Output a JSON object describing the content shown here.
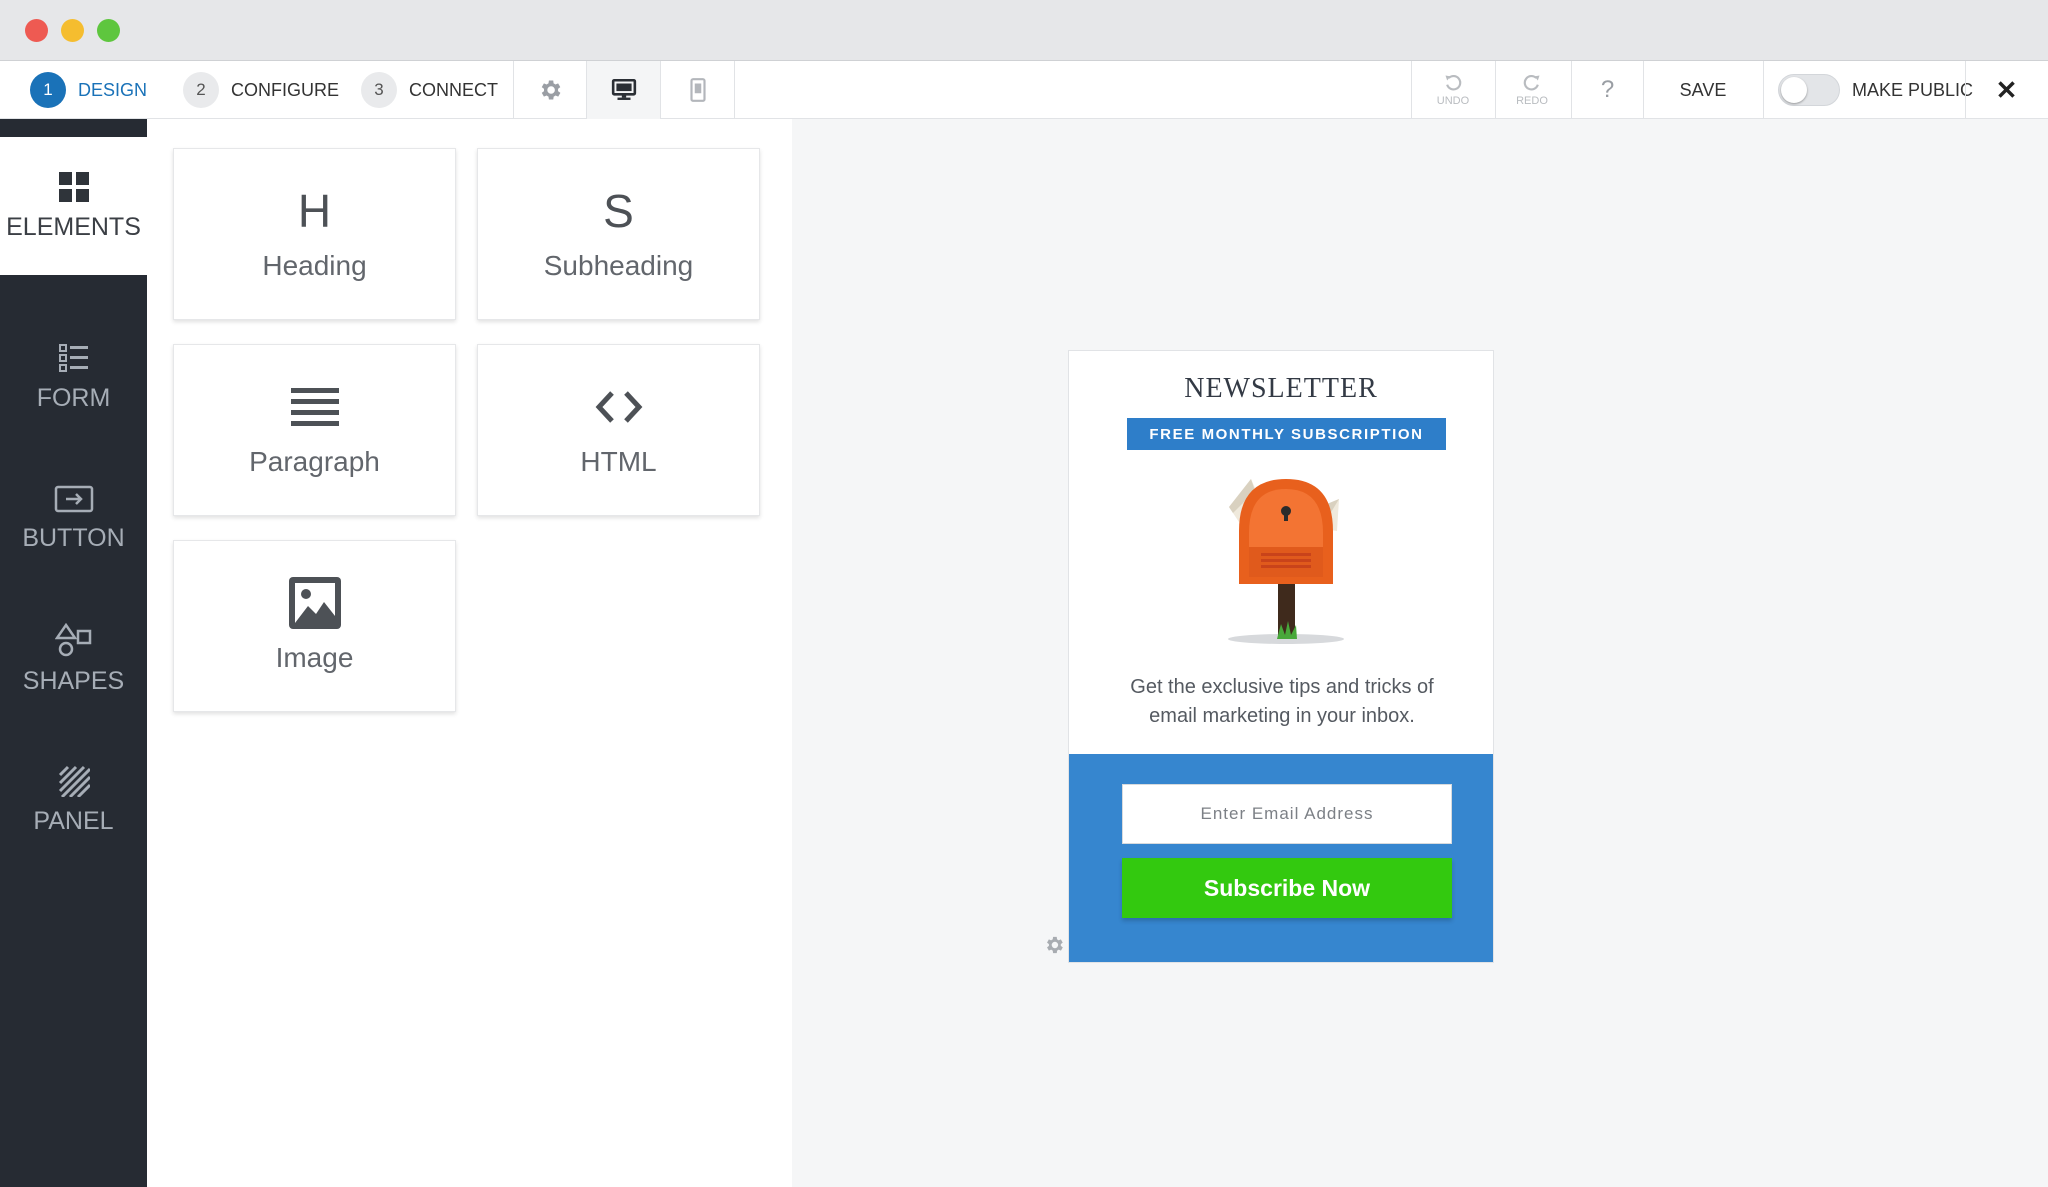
{
  "toolbar": {
    "steps": [
      {
        "num": "1",
        "label": "DESIGN"
      },
      {
        "num": "2",
        "label": "CONFIGURE"
      },
      {
        "num": "3",
        "label": "CONNECT"
      }
    ],
    "undo_label": "UNDO",
    "redo_label": "REDO",
    "help_label": "?",
    "save_label": "SAVE",
    "make_public_label": "MAKE PUBLIC",
    "close_label": "✕",
    "accent_color": "#1a72b8"
  },
  "rail": {
    "items": [
      {
        "label": "ELEMENTS",
        "icon": "grid-icon"
      },
      {
        "label": "FORM",
        "icon": "list-icon"
      },
      {
        "label": "BUTTON",
        "icon": "button-icon"
      },
      {
        "label": "SHAPES",
        "icon": "shapes-icon"
      },
      {
        "label": "PANEL",
        "icon": "panel-icon"
      }
    ]
  },
  "elements": {
    "tiles": [
      {
        "glyph": "H",
        "label": "Heading"
      },
      {
        "glyph": "S",
        "label": "Subheading"
      },
      {
        "glyph": "",
        "label": "Paragraph",
        "icon": "paragraph-icon"
      },
      {
        "glyph": "",
        "label": "HTML",
        "icon": "code-icon"
      },
      {
        "glyph": "",
        "label": "Image",
        "icon": "image-icon"
      }
    ]
  },
  "newsletter": {
    "title": "NEWSLETTER",
    "badge": "FREE MONTHLY SUBSCRIPTION",
    "body_line1": "Get the exclusive tips and tricks of",
    "body_line2": "email marketing in your inbox.",
    "email_placeholder": "Enter Email Address",
    "subscribe_label": "Subscribe Now",
    "badge_color": "#2e7ec9",
    "form_bg_color": "#3686cf",
    "button_color": "#33c90f"
  }
}
